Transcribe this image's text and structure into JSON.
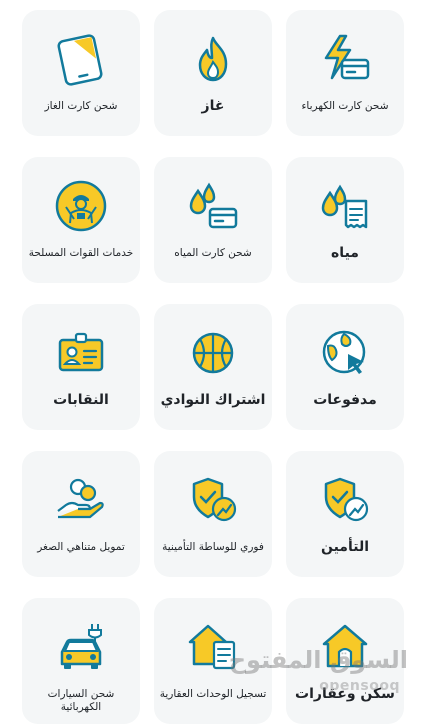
{
  "services": [
    {
      "label": "شحن كارت الكهرباء",
      "icon": "electricity-card-icon"
    },
    {
      "label": "غاز",
      "icon": "flame-icon"
    },
    {
      "label": "شحن كارت الغاز",
      "icon": "gas-card-phone-icon"
    },
    {
      "label": "مياه",
      "icon": "water-bill-icon"
    },
    {
      "label": "شحن كارت المياه",
      "icon": "water-card-icon"
    },
    {
      "label": "خدمات القوات المسلحة",
      "icon": "armed-forces-icon"
    },
    {
      "label": "مدفوعات",
      "icon": "globe-cursor-icon"
    },
    {
      "label": "اشتراك النوادي",
      "icon": "basketball-icon"
    },
    {
      "label": "النقابات",
      "icon": "id-badge-icon"
    },
    {
      "label": "التأمين",
      "icon": "shield-check-icon"
    },
    {
      "label": "فوري للوساطة التأمينية",
      "icon": "insurance-brokerage-icon"
    },
    {
      "label": "تمويل متناهي الصغر",
      "icon": "micro-finance-icon"
    },
    {
      "label": "سكن وعقارات",
      "icon": "house-icon"
    },
    {
      "label": "تسجيل الوحدات العقارية",
      "icon": "property-registration-icon"
    },
    {
      "label": "شحن السيارات الكهربائية",
      "icon": "ev-charging-icon"
    }
  ],
  "watermark": {
    "arabic": "السوق المفتوح",
    "latin": "opensooq"
  },
  "colors": {
    "tile": "#f4f6f7",
    "accent": "#f7c927",
    "stroke": "#127a9c",
    "text": "#1f2328"
  }
}
